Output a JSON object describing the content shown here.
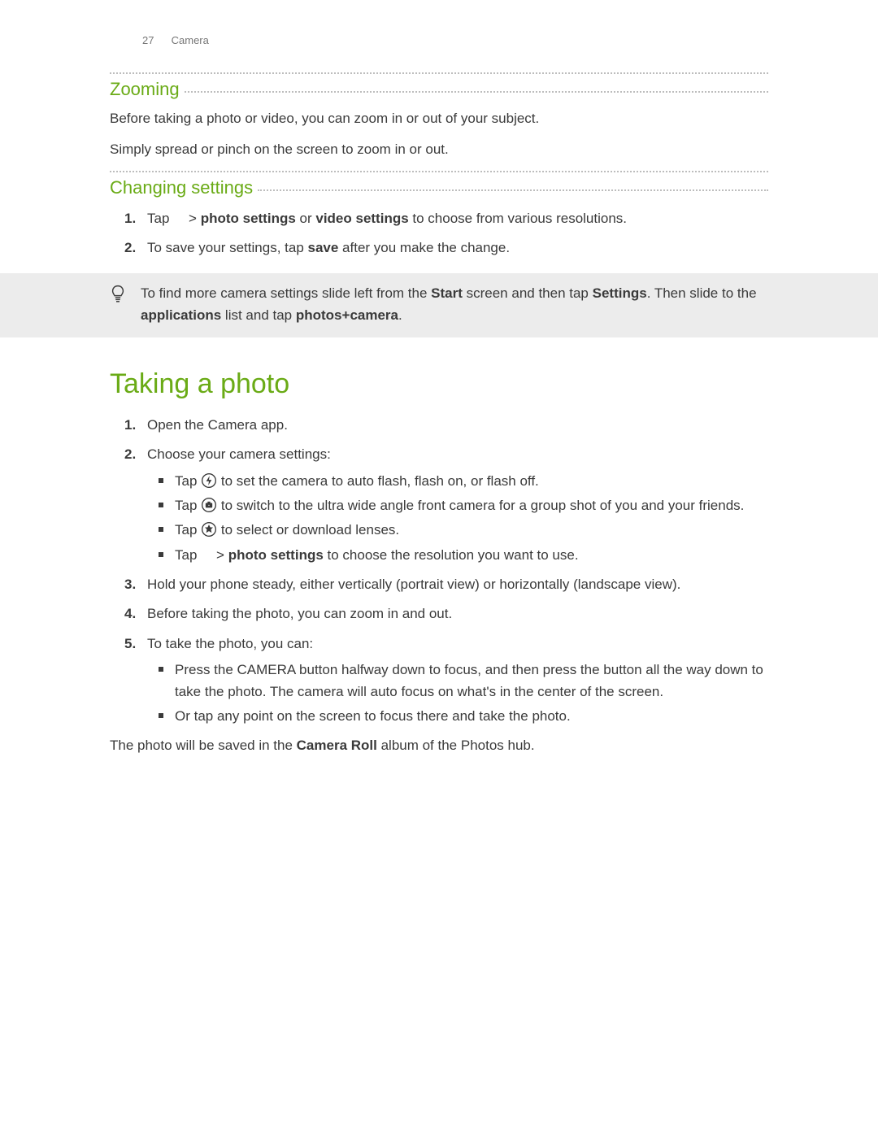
{
  "header": {
    "page_number": "27",
    "section": "Camera"
  },
  "zooming": {
    "heading": "Zooming",
    "para1": "Before taking a photo or video, you can zoom in or out of your subject.",
    "para2": "Simply spread or pinch on the screen to zoom in or out."
  },
  "changing": {
    "heading": "Changing settings",
    "step1": {
      "pre": "Tap ",
      "post_gt": " > ",
      "b1": "photo settings",
      "or": " or ",
      "b2": "video settings",
      "rest": " to choose from various resolutions."
    },
    "step2": {
      "pre": "To save your settings, tap ",
      "b1": "save",
      "rest": " after you make the change."
    }
  },
  "tip": {
    "t1": "To find more camera settings slide left from the ",
    "b1": "Start",
    "t2": " screen and then tap ",
    "b2": "Settings",
    "t3": ". Then slide to the ",
    "b3": "applications",
    "t4": " list and tap ",
    "b4": "photos+camera",
    "t5": "."
  },
  "taking": {
    "heading": "Taking a photo",
    "steps": {
      "s1": "Open the Camera app.",
      "s2": "Choose your camera settings:",
      "s2b": {
        "b1": {
          "pre": "Tap ",
          "post": " to set the camera to auto flash, flash on, or flash off."
        },
        "b2": {
          "pre": "Tap ",
          "post": " to switch to the ultra wide angle front camera for a group shot of you and your friends."
        },
        "b3": {
          "pre": "Tap ",
          "post": " to select or download lenses."
        },
        "b4": {
          "pre": "Tap ",
          "gt": " > ",
          "b": "photo settings",
          "post": " to choose the resolution you want to use."
        }
      },
      "s3": "Hold your phone steady, either vertically (portrait view) or horizontally (landscape view).",
      "s4": "Before taking the photo, you can zoom in and out.",
      "s5": "To take the photo, you can:",
      "s5b": {
        "b1": "Press the CAMERA button halfway down to focus, and then press the button all the way down to take the photo. The camera will auto focus on what's in the center of the screen.",
        "b2": "Or tap any point on the screen to focus there and take the photo."
      }
    },
    "closing": {
      "pre": "The photo will be saved in the ",
      "b": "Camera Roll",
      "post": " album of the Photos hub."
    }
  },
  "icons": {
    "flash": "flash-icon",
    "front_camera": "front-camera-icon",
    "lenses": "lenses-icon"
  }
}
